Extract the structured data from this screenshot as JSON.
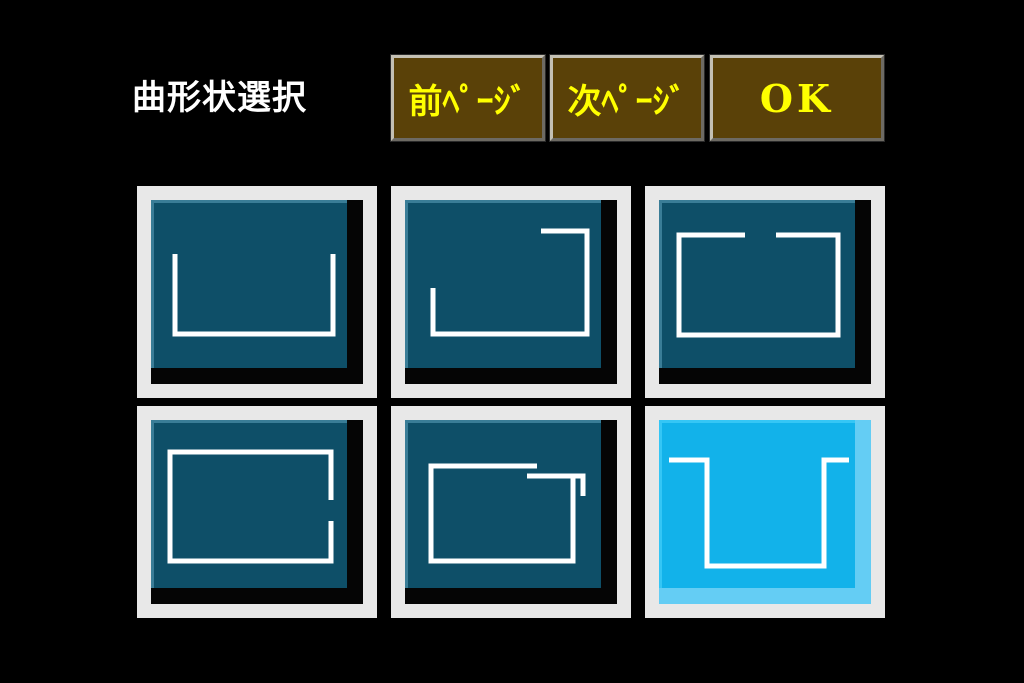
{
  "header": {
    "title": "曲形状選択",
    "prev_label": "前ﾍﾟｰｼﾞ",
    "next_label": "次ﾍﾟｰｼﾞ",
    "ok_label": "OK"
  },
  "colors": {
    "background": "#000000",
    "button_fill": "#5a4108",
    "button_text": "#ffff00",
    "tile_fill": "#0e4f68",
    "tile_selected_fill": "#12b2ea",
    "tile_frame": "#e8e8e8",
    "shape_stroke": "#ffffff"
  },
  "shapes": [
    {
      "name": "u-open-top",
      "selected": false
    },
    {
      "name": "u-with-top-right-hook",
      "selected": false
    },
    {
      "name": "rectangle-gap-top",
      "selected": false
    },
    {
      "name": "rectangle-gap-right",
      "selected": false
    },
    {
      "name": "rectangle-gap-top-right",
      "selected": false
    },
    {
      "name": "u-with-flanges",
      "selected": true
    }
  ]
}
